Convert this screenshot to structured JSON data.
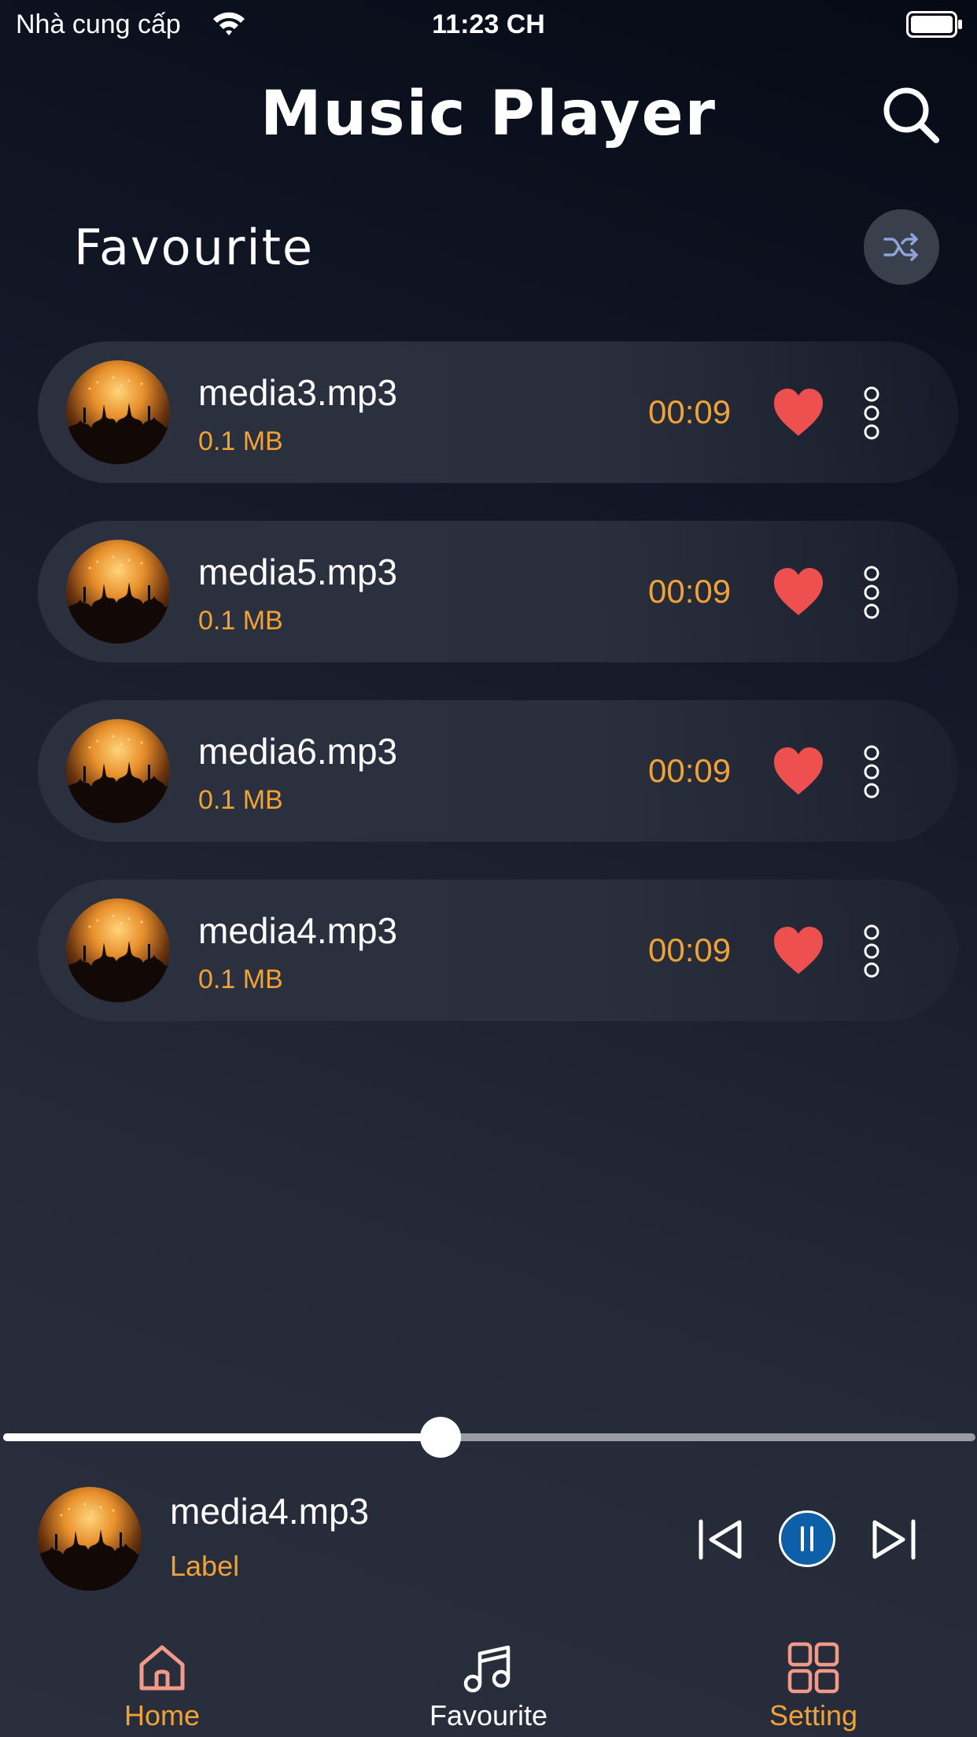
{
  "status_bar": {
    "carrier": "Nhà cung cấp",
    "time": "11:23 CH",
    "icons": [
      "wifi-icon",
      "battery-icon"
    ]
  },
  "header": {
    "title": "Music Player",
    "search_icon": "search-icon"
  },
  "section": {
    "title": "Favourite",
    "shuffle_icon": "shuffle-icon"
  },
  "tracks": [
    {
      "name": "media3.mp3",
      "size": "0.1 MB",
      "duration": "00:09",
      "favourite": true
    },
    {
      "name": "media5.mp3",
      "size": "0.1 MB",
      "duration": "00:09",
      "favourite": true
    },
    {
      "name": "media6.mp3",
      "size": "0.1 MB",
      "duration": "00:09",
      "favourite": true
    },
    {
      "name": "media4.mp3",
      "size": "0.1 MB",
      "duration": "00:09",
      "favourite": true
    }
  ],
  "player": {
    "title": "media4.mp3",
    "subtitle": "Label",
    "progress": 0.45,
    "state": "playing",
    "controls": [
      "previous-icon",
      "pause-icon",
      "next-icon"
    ]
  },
  "nav": {
    "items": [
      {
        "label": "Home",
        "icon": "home-icon",
        "color": "#f0a236",
        "icon_color": "#f2998a"
      },
      {
        "label": "Favourite",
        "icon": "music-note-icon",
        "color": "#ffffff",
        "icon_color": "#ffffff"
      },
      {
        "label": "Setting",
        "icon": "grid-icon",
        "color": "#f0a236",
        "icon_color": "#f2998a"
      }
    ]
  },
  "colors": {
    "accent": "#f0a236",
    "heart": "#ee4f4f",
    "play_button": "#0d5fa8",
    "background_dark": "#060a16",
    "row_background": "#2b303e"
  }
}
